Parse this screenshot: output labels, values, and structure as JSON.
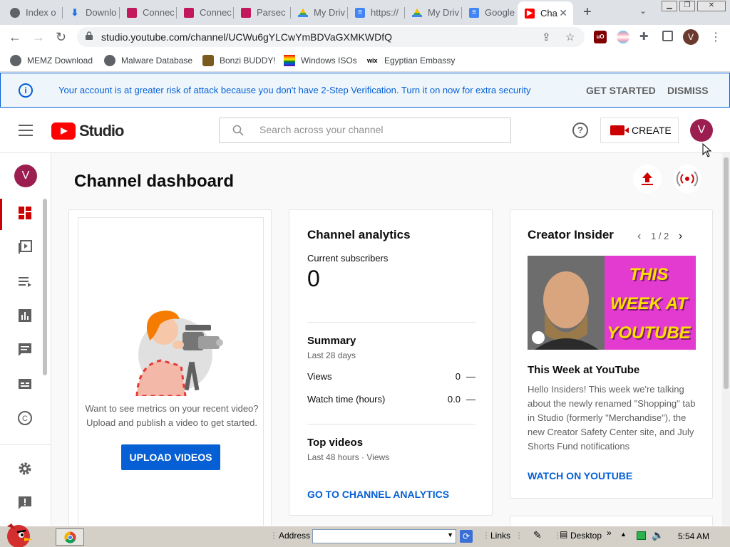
{
  "browser": {
    "tabs": [
      {
        "label": "Index o",
        "icon": "index-favicon"
      },
      {
        "label": "Downlo",
        "icon": "download-icon"
      },
      {
        "label": "Connec",
        "icon": "parsec-favicon"
      },
      {
        "label": "Connec",
        "icon": "parsec-favicon"
      },
      {
        "label": "Parsec",
        "icon": "parsec-favicon"
      },
      {
        "label": "My Driv",
        "icon": "google-drive-icon"
      },
      {
        "label": "https://",
        "icon": "google-docs-icon"
      },
      {
        "label": "My Driv",
        "icon": "google-drive-icon"
      },
      {
        "label": "Google",
        "icon": "google-docs-icon"
      },
      {
        "label": "Cha",
        "icon": "youtube-studio-favicon",
        "active": true
      }
    ],
    "url": "studio.youtube.com/channel/UCWu6gYLCwYmBDVaGXMKWDfQ",
    "profile_initial": "V",
    "bookmarks": [
      {
        "label": "MEMZ Download"
      },
      {
        "label": "Malware Database"
      },
      {
        "label": "Bonzi BUDDY!"
      },
      {
        "label": "Windows ISOs"
      },
      {
        "label": "Egyptian Embassy"
      }
    ]
  },
  "banner": {
    "message": "Your account is at greater risk of attack because you don't have 2-Step Verification. Turn it on now for extra security",
    "get_started": "GET STARTED",
    "dismiss": "DISMISS"
  },
  "header": {
    "logo_text": "Studio",
    "search_placeholder": "Search across your channel",
    "create_label": "CREATE",
    "avatar_initial": "V"
  },
  "sidebar": {
    "avatar_initial": "V",
    "items": [
      "dashboard-icon",
      "content-icon",
      "playlists-icon",
      "analytics-icon",
      "comments-icon",
      "subtitles-icon",
      "copyright-icon",
      "settings-icon",
      "feedback-icon"
    ],
    "active_index": 0
  },
  "dashboard": {
    "title": "Channel dashboard",
    "upload_card": {
      "prompt": "Want to see metrics on your recent video? Upload and publish a video to get started.",
      "button": "UPLOAD VIDEOS"
    },
    "analytics": {
      "title": "Channel analytics",
      "subscribers_label": "Current subscribers",
      "subscribers": "0",
      "summary_title": "Summary",
      "summary_period": "Last 28 days",
      "rows": [
        {
          "label": "Views",
          "value": "0",
          "trend": "—"
        },
        {
          "label": "Watch time (hours)",
          "value": "0.0",
          "trend": "—"
        }
      ],
      "top_videos_title": "Top videos",
      "top_videos_period": "Last 48 hours · Views",
      "link": "GO TO CHANNEL ANALYTICS"
    },
    "insider": {
      "title": "Creator Insider",
      "pager": "1 / 2",
      "thumb_text": "THIS WEEK AT YOUTUBE",
      "article_title": "This Week at YouTube",
      "article_body": "Hello Insiders! This week we're talking about the newly renamed \"Shopping\" tab in Studio (formerly \"Merchandise\"), the new Creator Safety Center site, and July Shorts Fund notifications",
      "link": "WATCH ON YOUTUBE"
    }
  },
  "taskbar": {
    "address_label": "Address",
    "links_label": "Links",
    "desktop_label": "Desktop",
    "clock": "5:54 AM"
  },
  "colors": {
    "accent": "#065fd4",
    "brand_red": "#ff0000",
    "active_nav": "#cc0000"
  }
}
